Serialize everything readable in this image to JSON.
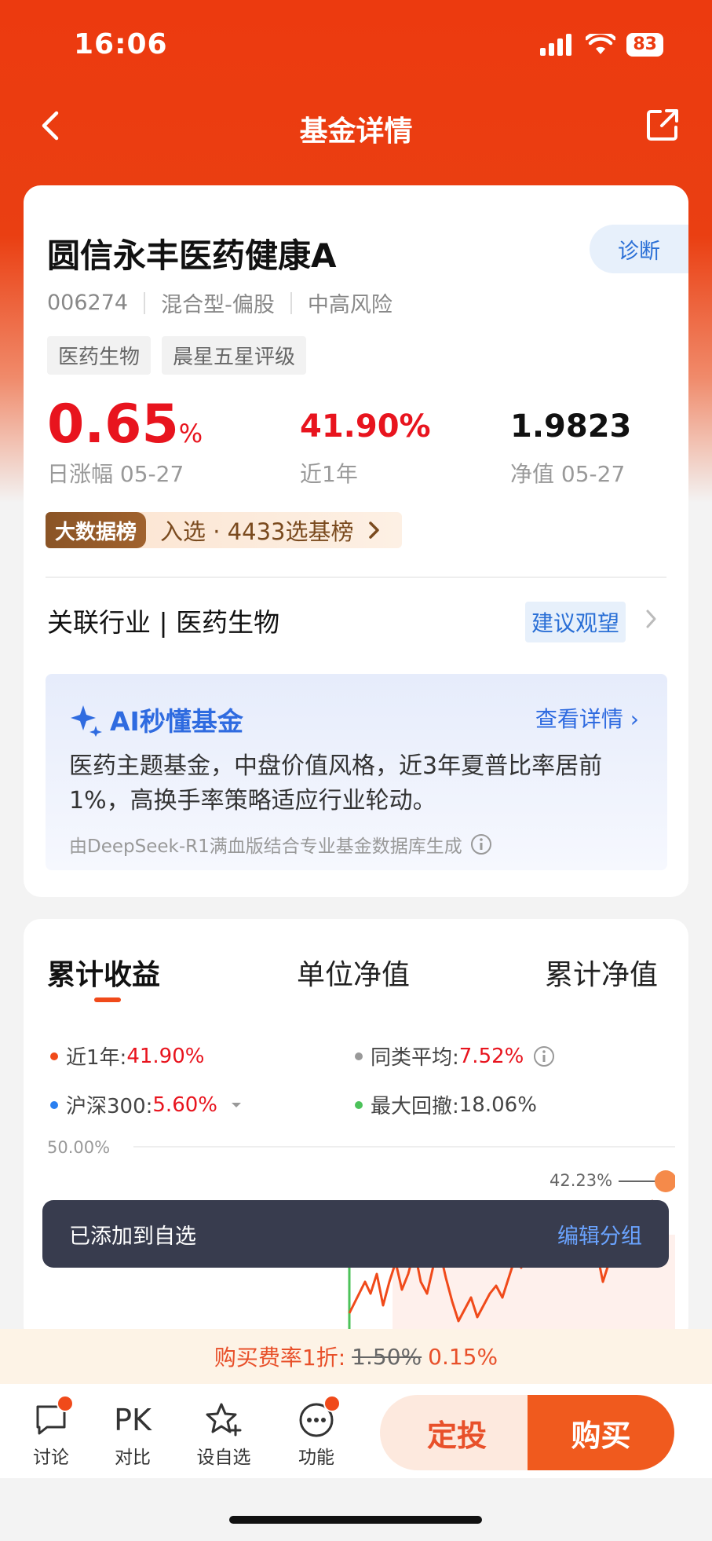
{
  "status_bar": {
    "time": "16:06",
    "battery": "83"
  },
  "nav": {
    "title": "基金详情"
  },
  "fund": {
    "name": "圆信永丰医药健康A",
    "diagnose_label": "诊断",
    "code": "006274",
    "type": "混合型-偏股",
    "risk": "中高风险",
    "tags": [
      "医药生物",
      "晨星五星评级"
    ],
    "daily_change": "0.65",
    "daily_change_unit": "%",
    "daily_change_label": "日涨幅 05-27",
    "year_return": "41.90%",
    "year_return_label": "近1年",
    "nav_value": "1.9823",
    "nav_label": "净值 05-27",
    "bigdata_badge": "大数据榜",
    "bigdata_text": "入选 · 4433选基榜",
    "industry": "关联行业 | 医药生物",
    "advice": "建议观望"
  },
  "ai": {
    "title": "AI秒懂基金",
    "more": "查看详情",
    "summary": "医药主题基金，中盘价值风格，近3年夏普比率居前1%，高换手率策略适应行业轮动。",
    "note": "由DeepSeek-R1满血版结合专业基金数据库生成"
  },
  "performance": {
    "tabs": [
      "累计收益",
      "单位净值",
      "累计净值"
    ],
    "legend": [
      {
        "label": "近1年:",
        "value": "41.90%",
        "color": "#f04a1a"
      },
      {
        "label": "同类平均:",
        "value": "7.52%",
        "color": "#999999"
      },
      {
        "label": "沪深300:",
        "value": "5.60%",
        "color": "#2a7ff0"
      },
      {
        "label": "最大回撤:",
        "value": "18.06%",
        "color": "#4cc25a"
      }
    ],
    "y_top_label": "50.00%",
    "peak_label": "42.23%"
  },
  "toast": {
    "message": "已添加到自选",
    "action": "编辑分组"
  },
  "fee": {
    "prefix": "购买费率1折:",
    "old": "1.50%",
    "new": "0.15%"
  },
  "bottom": {
    "items": [
      {
        "label": "讨论",
        "icon": "chat-icon"
      },
      {
        "label": "对比",
        "icon": "pk-icon",
        "icon_text": "PK"
      },
      {
        "label": "设自选",
        "icon": "star-add-icon"
      },
      {
        "label": "功能",
        "icon": "more-icon"
      }
    ],
    "sip_label": "定投",
    "buy_label": "购买"
  }
}
